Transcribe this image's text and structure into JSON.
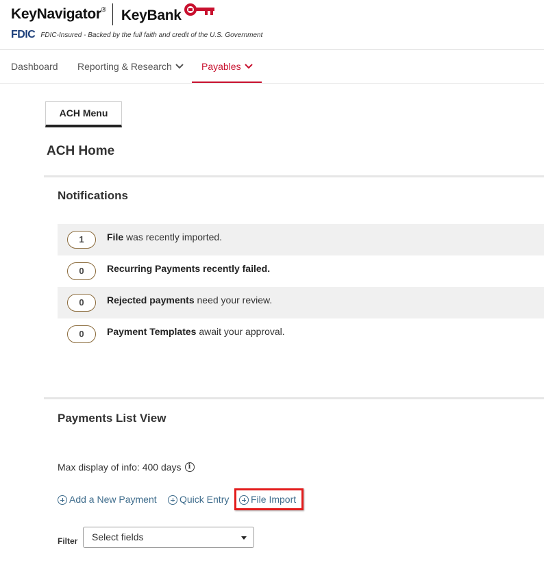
{
  "header": {
    "product_name": "KeyNavigator",
    "registered_mark": "®",
    "bank_name": "KeyBank",
    "fdic_logo": "FDIC",
    "fdic_text": "FDIC-Insured - Backed by the full faith and credit of the U.S. Government"
  },
  "nav": {
    "items": [
      {
        "label": "Dashboard"
      },
      {
        "label": "Reporting & Research"
      },
      {
        "label": "Payables"
      }
    ],
    "active": "Payables"
  },
  "tabs": {
    "ach_menu": "ACH Menu"
  },
  "page_title": "ACH Home",
  "notifications": {
    "title": "Notifications",
    "items": [
      {
        "count": "1",
        "bold": "File",
        "rest": " was recently imported."
      },
      {
        "count": "0",
        "bold": "Recurring Payments recently failed.",
        "rest": ""
      },
      {
        "count": "0",
        "bold": "Rejected payments",
        "rest": " need your review."
      },
      {
        "count": "0",
        "bold": "Payment Templates",
        "rest": " await your approval."
      }
    ]
  },
  "payments": {
    "title": "Payments List View",
    "max_display": "Max display of info: 400 days",
    "info_icon_glyph": "i",
    "links": {
      "add": "Add a New Payment",
      "quick": "Quick Entry",
      "import": "File Import"
    },
    "filter_label": "Filter",
    "filter_value": "Select fields"
  },
  "colors": {
    "brand_red": "#c8102e",
    "link_blue": "#3e6c8c",
    "highlight_red": "#e31c1c",
    "fdic_blue": "#1c3f7a"
  },
  "icons": [
    "key-logo-icon",
    "chevron-down-icon",
    "info-icon",
    "plus-circle-icon",
    "caret-down-icon"
  ]
}
